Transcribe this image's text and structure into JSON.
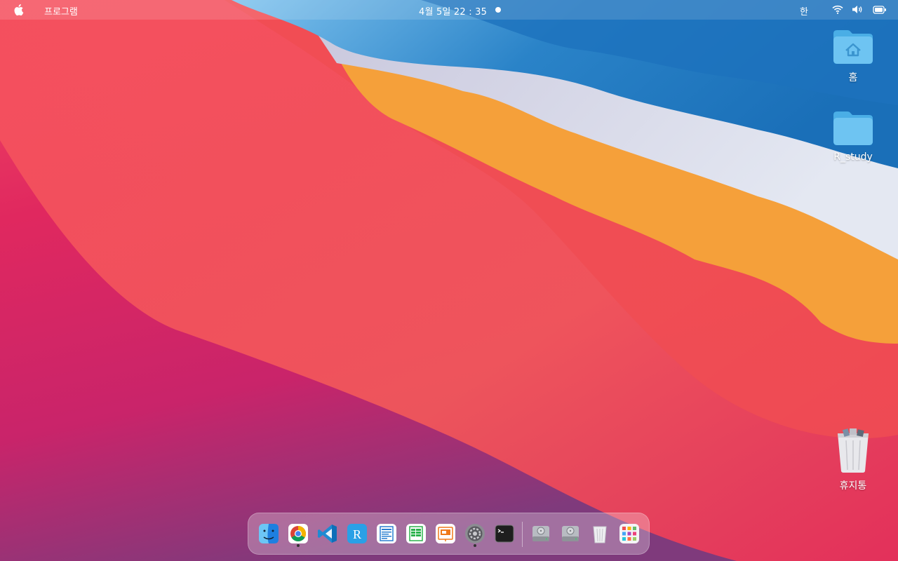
{
  "menubar": {
    "apple_icon": "apple-logo",
    "app_menu": "프로그램",
    "clock": "4월 5일  22 : 35",
    "input_method": "한",
    "status_icons": [
      "wifi-icon",
      "volume-icon",
      "battery-icon"
    ]
  },
  "desktop": {
    "home": {
      "label": "홈",
      "icon": "home-folder-icon"
    },
    "rstudy": {
      "label": "R_study",
      "icon": "folder-icon"
    },
    "trash": {
      "label": "휴지통",
      "icon": "trash-full-icon"
    }
  },
  "dock": {
    "items": [
      {
        "name": "finder",
        "icon": "finder-icon",
        "running": false
      },
      {
        "name": "chrome",
        "icon": "chrome-icon",
        "running": true
      },
      {
        "name": "vscode",
        "icon": "vscode-icon",
        "running": false
      },
      {
        "name": "r",
        "icon": "r-icon",
        "running": false
      },
      {
        "name": "writer",
        "icon": "writer-icon",
        "running": false
      },
      {
        "name": "calc",
        "icon": "calc-icon",
        "running": false
      },
      {
        "name": "impress",
        "icon": "impress-icon",
        "running": false
      },
      {
        "name": "settings",
        "icon": "settings-icon",
        "running": true
      },
      {
        "name": "terminal",
        "icon": "terminal-icon",
        "running": false
      },
      {
        "name": "drive1",
        "icon": "drive-icon",
        "running": false
      },
      {
        "name": "drive2",
        "icon": "drive-icon",
        "running": false
      },
      {
        "name": "trash",
        "icon": "trash-icon",
        "running": false
      },
      {
        "name": "launchpad",
        "icon": "launchpad-icon",
        "running": false
      }
    ]
  }
}
